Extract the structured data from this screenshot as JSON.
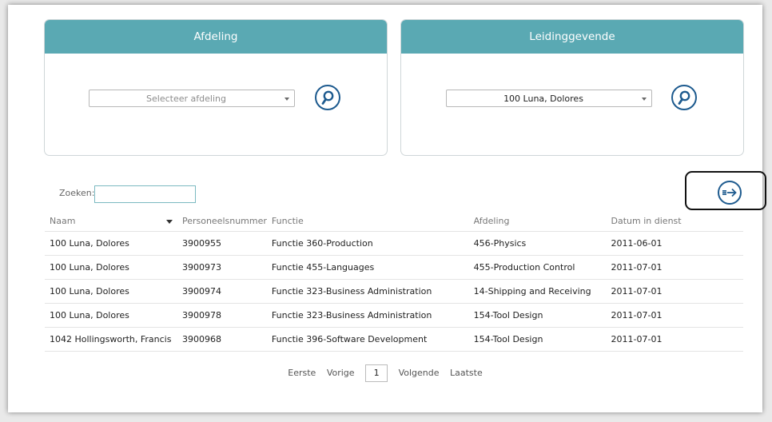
{
  "filters": {
    "department": {
      "title": "Afdeling",
      "placeholder": "Selecteer afdeling",
      "search_icon": "magnifier-icon"
    },
    "manager": {
      "title": "Leidinggevende",
      "selected": "100 Luna, Dolores",
      "search_icon": "magnifier-icon"
    }
  },
  "search": {
    "label": "Zoeken:",
    "value": ""
  },
  "export_icon": "export-arrow-icon",
  "table": {
    "columns": [
      "Naam",
      "Personeelsnummer",
      "Functie",
      "Afdeling",
      "Datum in dienst"
    ],
    "sort": {
      "column": "Naam",
      "direction": "descending"
    },
    "rows": [
      [
        "100 Luna, Dolores",
        "3900955",
        "Functie 360-Production",
        "456-Physics",
        "2011-06-01"
      ],
      [
        "100 Luna, Dolores",
        "3900973",
        "Functie 455-Languages",
        "455-Production Control",
        "2011-07-01"
      ],
      [
        "100 Luna, Dolores",
        "3900974",
        "Functie 323-Business Administration",
        "14-Shipping and Receiving",
        "2011-07-01"
      ],
      [
        "100 Luna, Dolores",
        "3900978",
        "Functie 323-Business Administration",
        "154-Tool Design",
        "2011-07-01"
      ],
      [
        "1042 Hollingsworth, Francis",
        "3900968",
        "Functie 396-Software Development",
        "154-Tool Design",
        "2011-07-01"
      ]
    ]
  },
  "pager": {
    "first": "Eerste",
    "prev": "Vorige",
    "page": "1",
    "next": "Volgende",
    "last": "Laatste"
  },
  "colors": {
    "header": "#5aa9b3",
    "icon": "#1e5b8f"
  }
}
